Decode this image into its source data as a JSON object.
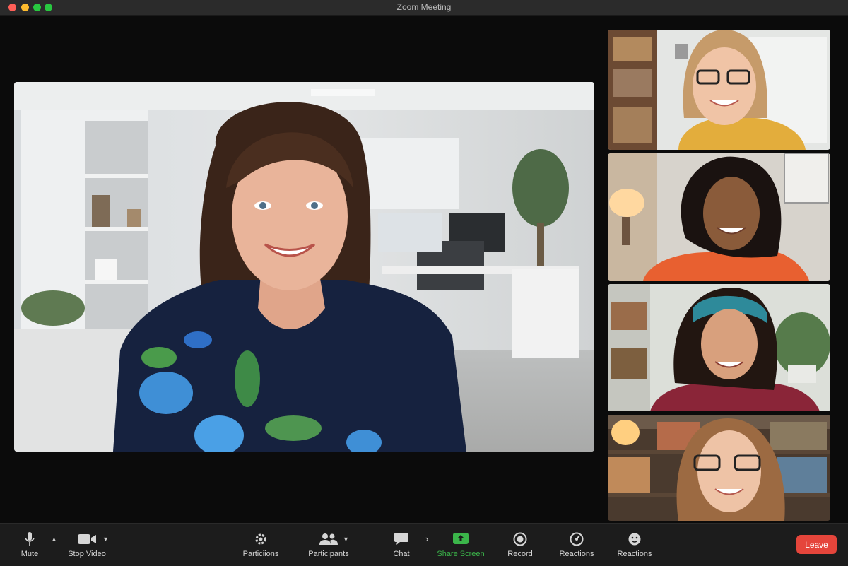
{
  "window": {
    "title": "Zoom Meeting"
  },
  "colors": {
    "leave": "#e5453b",
    "share_screen": "#3bb54a",
    "toolbar_bg": "#1c1c1c"
  },
  "toolbar": {
    "mute_label": "Mute",
    "stop_video_label": "Stop Video",
    "settings_label": "Particiions",
    "participants_label": "Participants",
    "chat_label": "Chat",
    "share_screen_label": "Share Screen",
    "record_label": "Record",
    "reactions_label": "Reactions",
    "reactions2_label": "Reactions",
    "leave_label": "Leave"
  },
  "icons": [
    "microphone-icon",
    "video-camera-icon",
    "gear-icon",
    "participants-icon",
    "chat-bubble-icon",
    "share-screen-icon",
    "record-icon",
    "reactions-icon",
    "emoji-icon"
  ]
}
